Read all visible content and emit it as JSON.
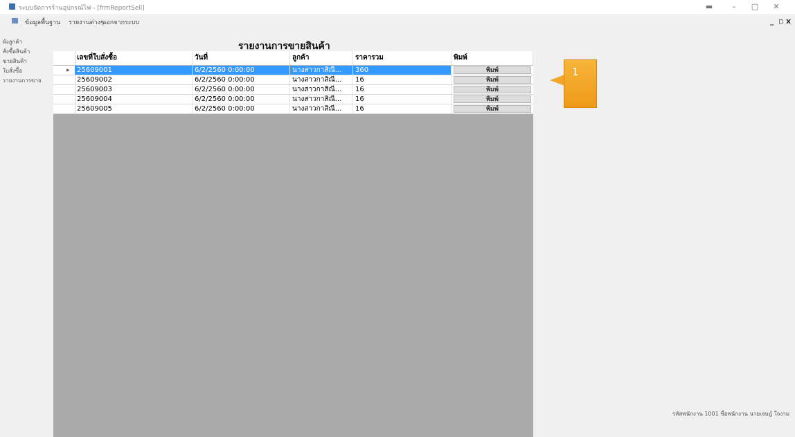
{
  "window": {
    "title": "ระบบจัดการร้านอุปกรณ์ไฟ - [frmReportSell]",
    "controls": {
      "minimize": "–",
      "maximize": "▢",
      "close": "✕"
    }
  },
  "menubar": {
    "items": [
      "ข้อมูลพื้นฐาน",
      "รายงานต่างๆ",
      "ออกจากระบบ"
    ],
    "mdi_controls": {
      "minimize": "_",
      "restore": "▫",
      "close": "x"
    }
  },
  "sidebar": {
    "items": [
      "ผังลูกค้า",
      "สั่งซื้อสินค้า",
      "ขายสินค้า",
      "ใบสั่งซื้อ",
      "รายงานการขาย"
    ]
  },
  "report": {
    "title": "รายงานการขายสินค้า",
    "columns": [
      "เลขที่ใบสั่งซื้อ",
      "วันที่",
      "ลูกค้า",
      "ราคารวม",
      "พิมพ์"
    ],
    "rows": [
      {
        "id": "25609001",
        "date": "6/2/2560 0:00:00",
        "customer": "นางสาวกาสิณี...",
        "total": "360",
        "action": "พิมพ์",
        "selected": true
      },
      {
        "id": "25609002",
        "date": "6/2/2560 0:00:00",
        "customer": "นางสาวกาสิณี...",
        "total": "16",
        "action": "พิมพ์",
        "selected": false
      },
      {
        "id": "25609003",
        "date": "6/2/2560 0:00:00",
        "customer": "นางสาวกาสิณี...",
        "total": "16",
        "action": "พิมพ์",
        "selected": false
      },
      {
        "id": "25609004",
        "date": "6/2/2560 0:00:00",
        "customer": "นางสาวกาสิณี...",
        "total": "16",
        "action": "พิมพ์",
        "selected": false
      },
      {
        "id": "25609005",
        "date": "6/2/2560 0:00:00",
        "customer": "นางสาวกาสิณี...",
        "total": "16",
        "action": "พิมพ์",
        "selected": false
      }
    ]
  },
  "callout": {
    "label": "1",
    "color": "#f3a728"
  },
  "statusbar": {
    "text": "รหัสพนักงาน 1001 ชื่อพนักงาน นายเจษฎ์ ใจงาม"
  },
  "colors": {
    "selection": "#3399ff",
    "grid_bg": "#ababab"
  }
}
